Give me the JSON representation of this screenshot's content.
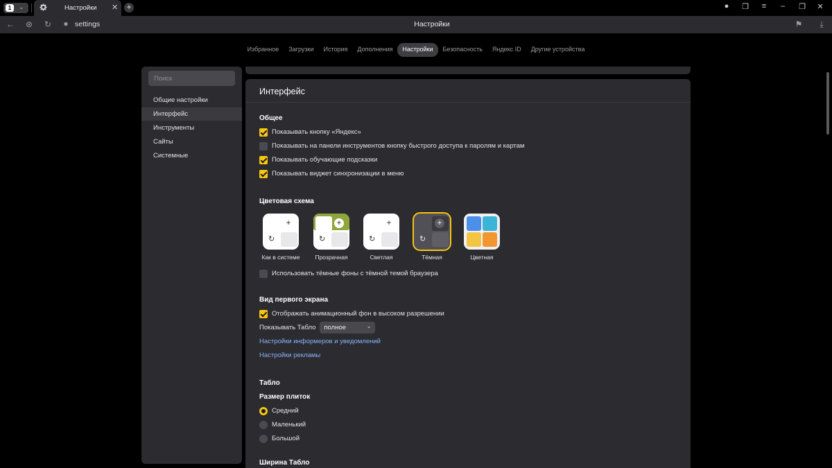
{
  "browser": {
    "tab_count": "1",
    "tab_title": "Настройки",
    "address": "settings",
    "page_title": "Настройки"
  },
  "topnav": [
    "Избранное",
    "Загрузки",
    "История",
    "Дополнения",
    "Настройки",
    "Безопасность",
    "Яндекс ID",
    "Другие устройства"
  ],
  "topnav_active": "Настройки",
  "sidebar": {
    "search_placeholder": "Поиск",
    "items": [
      "Общие настройки",
      "Интерфейс",
      "Инструменты",
      "Сайты",
      "Системные"
    ],
    "active": "Интерфейс"
  },
  "panel": {
    "title": "Интерфейс",
    "general": {
      "heading": "Общее",
      "options": [
        {
          "label": "Показывать кнопку «Яндекс»",
          "checked": true
        },
        {
          "label": "Показывать на панели инструментов кнопку быстрого доступа к паролям и картам",
          "checked": false
        },
        {
          "label": "Показывать обучающие подсказки",
          "checked": true
        },
        {
          "label": "Показывать виджет синхронизации в меню",
          "checked": true
        }
      ]
    },
    "color_scheme": {
      "heading": "Цветовая схема",
      "themes": [
        "Как в системе",
        "Прозрачная",
        "Светлая",
        "Тёмная",
        "Цветная"
      ],
      "selected": "Тёмная",
      "dark_bg_option": {
        "label": "Использовать тёмные фоны с тёмной темой браузера",
        "checked": false
      }
    },
    "first_screen": {
      "heading": "Вид первого экрана",
      "animated_bg": {
        "label": "Отображать анимационный фон в высоком разрешении",
        "checked": true
      },
      "show_tablo_label": "Показывать Табло",
      "show_tablo_value": "полное",
      "links": [
        "Настройки информеров и уведомлений",
        "Настройки рекламы"
      ]
    },
    "tablo": {
      "heading": "Табло",
      "tile_size_heading": "Размер плиток",
      "sizes": [
        "Средний",
        "Маленький",
        "Большой"
      ],
      "selected_size": "Средний",
      "width_heading": "Ширина Табло"
    }
  },
  "colors": {
    "accent": "#f8c514",
    "link": "#8ab4f8",
    "panel_bg": "#2b2b30",
    "page_bg": "#000000"
  }
}
